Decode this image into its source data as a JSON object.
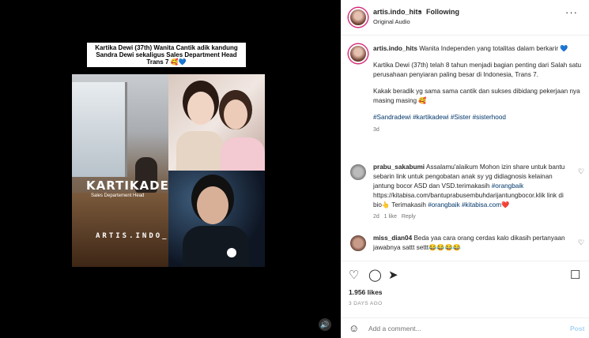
{
  "media": {
    "banner_text": "Kartika Dewi (37th) Wanita Cantik adik kandung Sandra Dewi sekaligus Sales Department Head Trans 7 🥰💙",
    "overlay_name": "KARTIKADEWI",
    "overlay_subtitle": "Sales Departement Head",
    "watermark": "ARTIS.INDO_HITS",
    "audio_icon": "speaker-icon"
  },
  "header": {
    "username": "artis.indo_hits",
    "separator": "•",
    "following_label": "Following",
    "audio_label": "Original Audio",
    "more_icon": "more-icon"
  },
  "caption": {
    "username": "artis.indo_hits",
    "line1": "Wanita Independen yang totalitas dalam berkarir 💙",
    "para1": "Kartika Dewi (37th) telah 8 tahun menjadi bagian penting dari Salah satu perusahaan penyiaran paling besar di Indonesia, Trans 7.",
    "para2": "Kakak beradik yg sama sama cantik dan sukses dibidang pekerjaan nya masing masing 🥰",
    "hashtags": "#Sandradewi #kartikadewi #Sister #sisterhood",
    "time": "3d"
  },
  "comments": [
    {
      "username": "prabu_sakabumi",
      "text_a": "Assalamu'alaikum Mohon izin share untuk bantu sebarin link untuk pengobatan anak sy yg didiagnosis kelainan jantung bocor ASD dan VSD.terimakasih ",
      "tag_a": "#orangbaik",
      "text_b": " https://kitabisa.com/bantuprabusembuhdarijantungbocor.klik link di bio👆 Terimakasih ",
      "tag_b": "#orangbaik #kitabisa.com",
      "text_c": "❤️",
      "time": "2d",
      "likes": "1 like",
      "reply": "Reply"
    },
    {
      "username": "miss_dian04",
      "text": "Beda yaa cara orang cerdas kalo dikasih pertanyaan jawabnya sattt settt😂😂😂😂"
    }
  ],
  "actions": {
    "likes": "1.956 likes",
    "date": "3 DAYS AGO"
  },
  "comment_bar": {
    "placeholder": "Add a comment...",
    "post_label": "Post"
  }
}
